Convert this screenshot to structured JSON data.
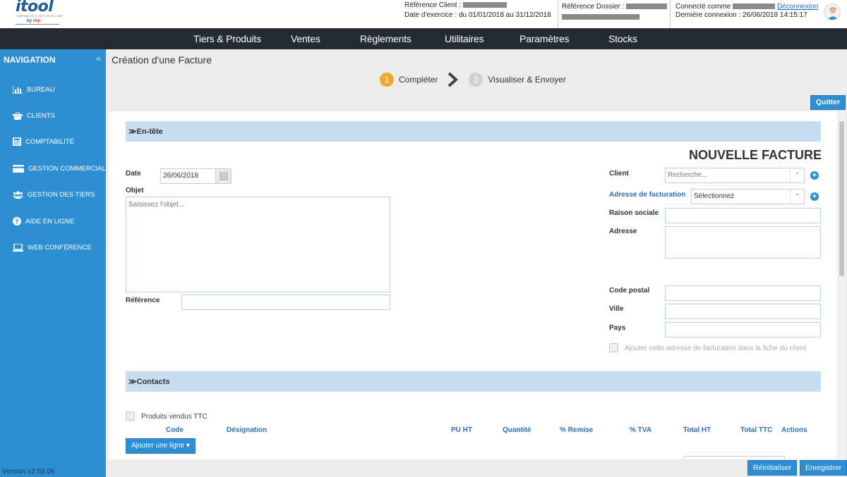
{
  "logo": {
    "word": "itool",
    "tagline": "COMPTABILITÉ ET GESTION EN LIGNE",
    "brand_prefix": "by",
    "brand": "ebp"
  },
  "header": {
    "ref_client_label": "Référence Client :",
    "exercise_label": "Date d'exercice :",
    "exercise_value": "du 01/01/2018 au 31/12/2018",
    "ref_dossier_label": "Référence Dossier :",
    "connected_label": "Connecté comme",
    "logout": "Déconnexion",
    "last_login": "Dernière connexion : 26/06/2018 14:15:17"
  },
  "menu": [
    "Tiers & Produits",
    "Ventes",
    "Règlements",
    "Utilitaires",
    "Paramètres",
    "Stocks"
  ],
  "sidebar": {
    "title": "NAVIGATION",
    "collapse": "«",
    "items": [
      {
        "label": "Bureau",
        "icon": "bar-chart-icon"
      },
      {
        "label": "Clients",
        "icon": "basket-icon"
      },
      {
        "label": "Comptabilité",
        "icon": "calculator-icon"
      },
      {
        "label": "Gestion commerciale",
        "icon": "credit-card-icon"
      },
      {
        "label": "Gestion des tiers",
        "icon": "users-icon"
      },
      {
        "label": "Aide en ligne",
        "icon": "question-icon"
      },
      {
        "label": "Web conférence",
        "icon": "laptop-icon"
      }
    ],
    "version": "Version v2.58.06"
  },
  "page": {
    "title": "Création d'une Facture",
    "steps": [
      {
        "num": "1",
        "label": "Compléter",
        "color": "#f0a830"
      },
      {
        "num": "2",
        "label": "Visualiser & Envoyer",
        "color": "#d0d0d0"
      }
    ],
    "quit": "Quitter"
  },
  "entete": {
    "section": "En-tête",
    "big_title": "NOUVELLE FACTURE",
    "date_label": "Date",
    "date_value": "26/06/2018",
    "objet_label": "Objet",
    "objet_placeholder": "Saisissez l'objet...",
    "reference_label": "Référence",
    "client_label": "Client",
    "client_placeholder": "Recherche...",
    "adresse_fact_label": "Adresse de facturation",
    "adresse_fact_value": "Sélectionnez",
    "raison_label": "Raison sociale",
    "adresse_label": "Adresse",
    "cp_label": "Code postal",
    "ville_label": "Ville",
    "pays_label": "Pays",
    "add_address_checkbox": "Ajouter cette adresse de facturation dans la fiche du client"
  },
  "contacts": {
    "section": "Contacts"
  },
  "lines": {
    "ttc_checkbox": "Produits vendus TTC",
    "columns": [
      "Code",
      "Désignation",
      "PU HT",
      "Quantité",
      "% Remise",
      "% TVA",
      "Total HT",
      "Total TTC",
      "Actions"
    ],
    "add_line": "Ajouter une ligne ▾"
  },
  "footer": {
    "reset": "Réinitialiser",
    "save": "Enregistrer"
  },
  "colors": {
    "accent": "#2d8ed2",
    "menubar": "#252b33",
    "section": "#c9ddf0"
  }
}
